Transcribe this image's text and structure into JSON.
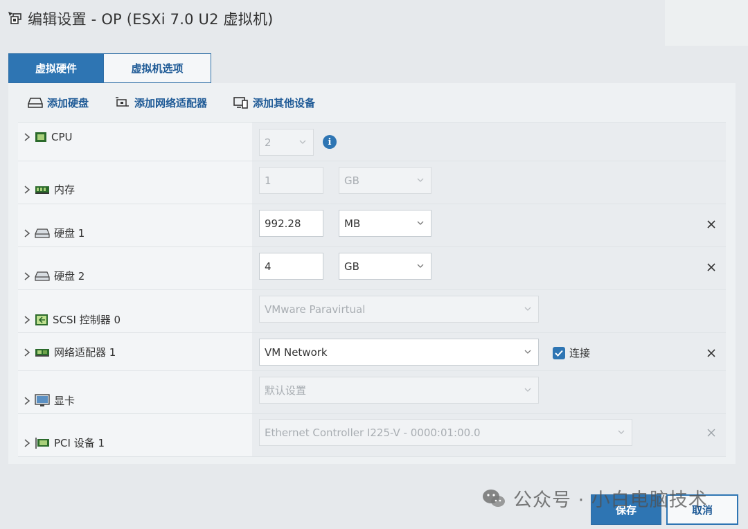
{
  "window": {
    "title": "编辑设置 - OP (ESXi 7.0 U2 虚拟机)"
  },
  "tabs": [
    {
      "label": "虚拟硬件",
      "active": true
    },
    {
      "label": "虚拟机选项",
      "active": false
    }
  ],
  "toolbar": {
    "add_disk": "添加硬盘",
    "add_network": "添加网络适配器",
    "add_other": "添加其他设备"
  },
  "rows": {
    "cpu": {
      "label": "CPU",
      "value": "2",
      "info_icon": "i"
    },
    "memory": {
      "label": "内存",
      "value": "1",
      "unit": "GB"
    },
    "disk1": {
      "label": "硬盘 1",
      "value": "992.28",
      "unit": "MB"
    },
    "disk2": {
      "label": "硬盘 2",
      "value": "4",
      "unit": "GB"
    },
    "scsi": {
      "label": "SCSI 控制器 0",
      "value": "VMware Paravirtual"
    },
    "network": {
      "label": "网络适配器 1",
      "value": "VM Network",
      "connect_label": "连接",
      "connected": true
    },
    "video": {
      "label": "显卡",
      "value": "默认设置"
    },
    "pci": {
      "label": "PCI 设备 1",
      "value": "Ethernet Controller I225-V - 0000:01:00.0"
    }
  },
  "footer": {
    "save": "保存",
    "cancel": "取消"
  },
  "watermark": {
    "text": "公众号 · 小白电脑技术"
  },
  "colors": {
    "accent": "#2e75b3",
    "link": "#1e5a96",
    "background": "#e6e9ec"
  }
}
